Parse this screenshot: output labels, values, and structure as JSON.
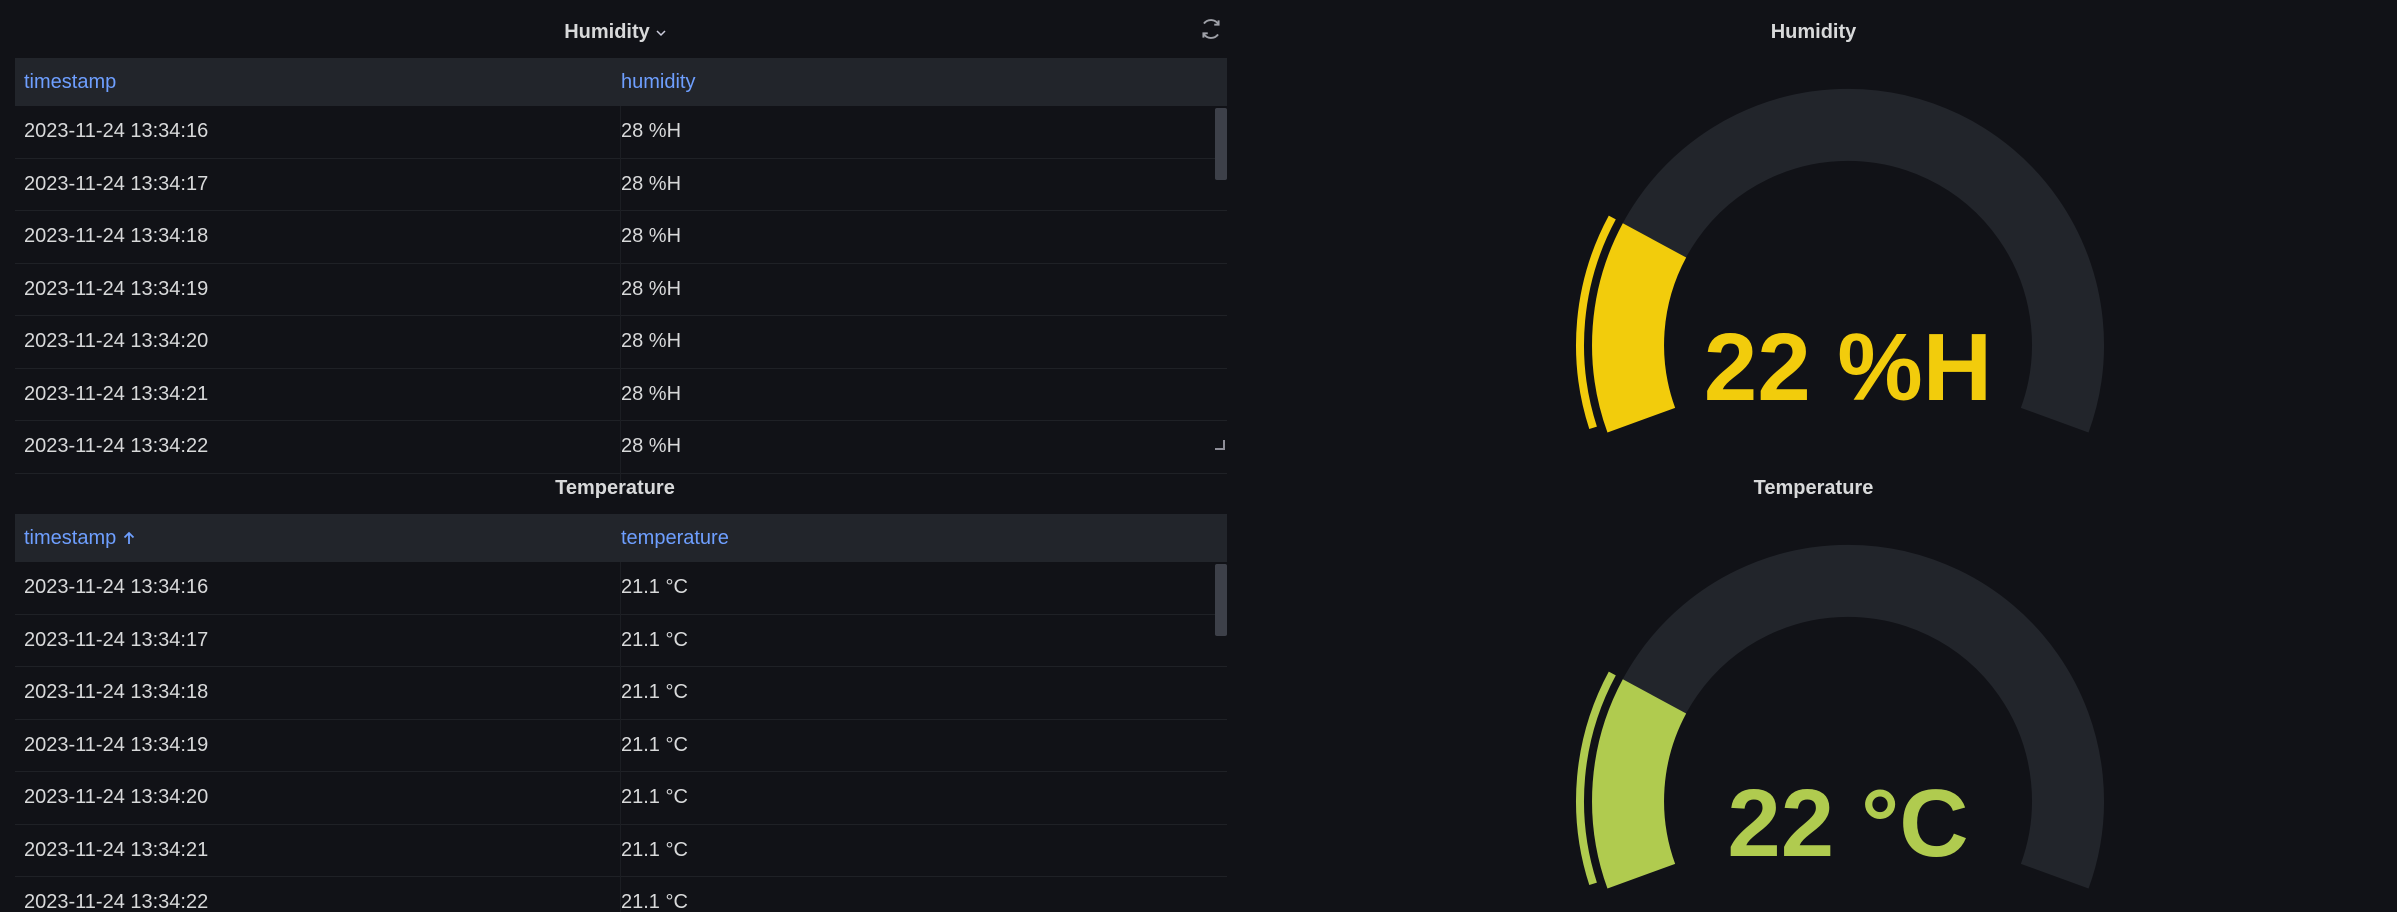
{
  "humidity_table": {
    "title": "Humidity",
    "columns": [
      "timestamp",
      "humidity"
    ],
    "rows": [
      [
        "2023-11-24 13:34:16",
        "28 %H"
      ],
      [
        "2023-11-24 13:34:17",
        "28 %H"
      ],
      [
        "2023-11-24 13:34:18",
        "28 %H"
      ],
      [
        "2023-11-24 13:34:19",
        "28 %H"
      ],
      [
        "2023-11-24 13:34:20",
        "28 %H"
      ],
      [
        "2023-11-24 13:34:21",
        "28 %H"
      ],
      [
        "2023-11-24 13:34:22",
        "28 %H"
      ]
    ]
  },
  "temperature_table": {
    "title": "Temperature",
    "columns": [
      "timestamp",
      "temperature"
    ],
    "sort_column": "timestamp",
    "sort_direction": "ascending",
    "rows": [
      [
        "2023-11-24 13:34:16",
        "21.1 °C"
      ],
      [
        "2023-11-24 13:34:17",
        "21.1 °C"
      ],
      [
        "2023-11-24 13:34:18",
        "21.1 °C"
      ],
      [
        "2023-11-24 13:34:19",
        "21.1 °C"
      ],
      [
        "2023-11-24 13:34:20",
        "21.1 °C"
      ],
      [
        "2023-11-24 13:34:21",
        "21.1 °C"
      ],
      [
        "2023-11-24 13:34:22",
        "21.1 °C"
      ]
    ]
  },
  "humidity_gauge": {
    "title": "Humidity",
    "value_text": "22 %H",
    "fill_fraction": 0.22,
    "color": "#f2cc0c",
    "track_color": "#22252b"
  },
  "temperature_gauge": {
    "title": "Temperature",
    "value_text": "22 °C",
    "fill_fraction": 0.22,
    "color": "#b0cb4f",
    "track_color": "#22252b"
  },
  "icons": {
    "refresh": "refresh-icon",
    "title_dropdown": "chevron-down-icon",
    "sort_ascending": "arrow-up-icon"
  }
}
